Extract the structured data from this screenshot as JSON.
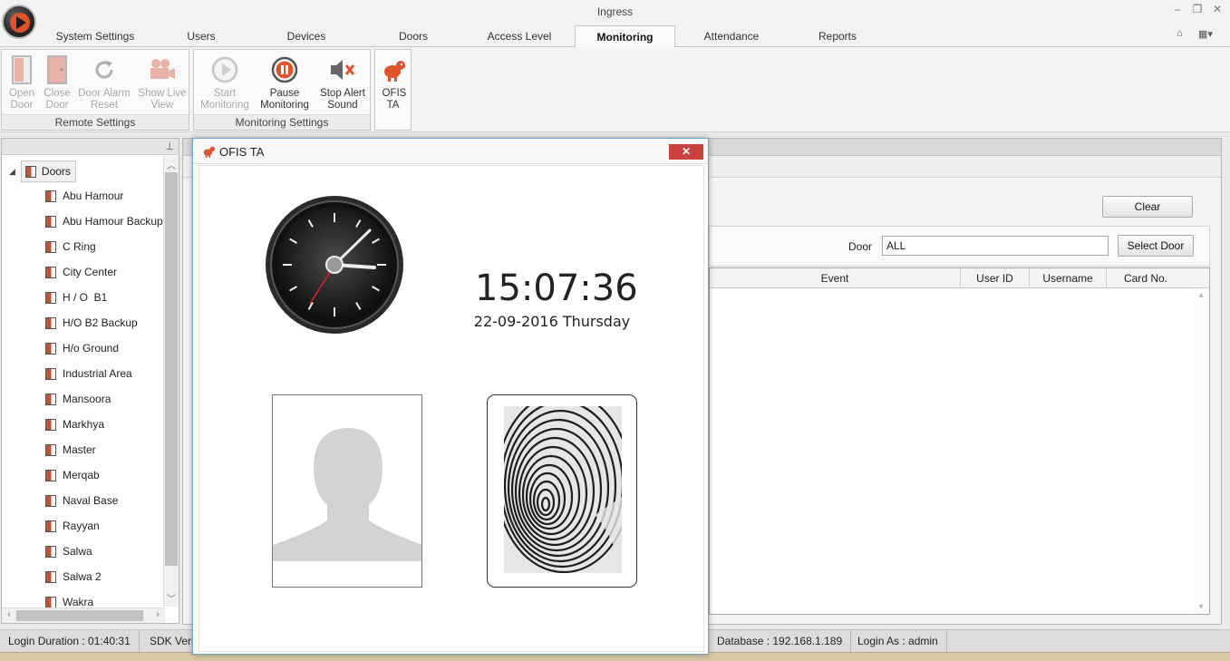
{
  "window": {
    "title": "Ingress"
  },
  "tabs": [
    {
      "label": "System Settings"
    },
    {
      "label": "Users"
    },
    {
      "label": "Devices"
    },
    {
      "label": "Doors"
    },
    {
      "label": "Access Level"
    },
    {
      "label": "Monitoring",
      "active": true
    },
    {
      "label": "Attendance"
    },
    {
      "label": "Reports"
    }
  ],
  "ribbon": {
    "remote_settings": {
      "label": "Remote Settings",
      "open_door": "Open Door",
      "close_door": "Close Door",
      "door_alarm_reset": "Door Alarm Reset",
      "show_live_view": "Show Live View"
    },
    "monitoring_settings": {
      "label": "Monitoring Settings",
      "start_monitoring": "Start Monitoring",
      "pause_monitoring": "Pause Monitoring",
      "stop_alert_sound": "Stop Alert Sound"
    },
    "ofis_ta": "OFIS TA"
  },
  "tree": {
    "root": "Doors",
    "items": [
      "Abu Hamour",
      "Abu Hamour Backup",
      "C Ring",
      "City Center",
      "H / O  B1",
      "H/O B2 Backup",
      "H/o Ground",
      "Industrial Area",
      "Mansoora",
      "Markhya",
      "Master",
      "Merqab",
      "Naval Base",
      "Rayyan",
      "Salwa",
      "Salwa 2",
      "Wakra"
    ]
  },
  "main": {
    "clear_button": "Clear",
    "door_label": "Door",
    "door_value": "ALL",
    "select_door_button": "Select Door",
    "columns": [
      "Event",
      "User ID",
      "Username",
      "Card No."
    ]
  },
  "dialog": {
    "title": "OFIS TA",
    "close": "✕",
    "time": "15:07:36",
    "date": "22-09-2016 Thursday"
  },
  "status": {
    "login_duration": "Login Duration : 01:40:31",
    "sdk": "SDK Vers",
    "database": "Database : 192.168.1.189",
    "login_as": "Login As : admin"
  },
  "colors": {
    "accent_red": "#c9413f",
    "app_orange": "#e0532b",
    "dialog_border": "#6fa6c9"
  },
  "icons": [
    "play-orb-icon",
    "door-icon",
    "alarm-reset-icon",
    "camera-icon",
    "play-icon",
    "pause-icon",
    "speaker-mute-icon",
    "ofis-ta-icon",
    "pin-icon",
    "clock-icon",
    "person-silhouette-icon",
    "fingerprint-icon"
  ]
}
